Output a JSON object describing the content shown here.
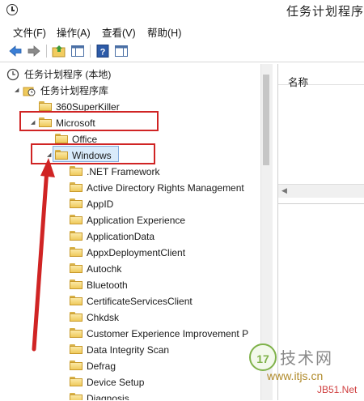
{
  "window": {
    "title": "任务计划程序"
  },
  "menu": [
    {
      "label": "文件(F)"
    },
    {
      "label": "操作(A)"
    },
    {
      "label": "查看(V)"
    },
    {
      "label": "帮助(H)"
    }
  ],
  "toolbar": {
    "icons": [
      "back-arrow-icon",
      "forward-arrow-icon",
      "up-folder-icon",
      "show-hide-tree-icon",
      "help-icon",
      "action-pane-icon"
    ]
  },
  "tree": {
    "root": "任务计划程序 (本地)",
    "library": "任务计划程序库",
    "top_folders": [
      "360SuperKiller",
      "Microsoft"
    ],
    "microsoft_children": [
      "Office",
      "Windows"
    ],
    "windows_children": [
      ".NET Framework",
      "Active Directory Rights Management",
      "AppID",
      "Application Experience",
      "ApplicationData",
      "AppxDeploymentClient",
      "Autochk",
      "Bluetooth",
      "CertificateServicesClient",
      "Chkdsk",
      "Customer Experience Improvement P",
      "Data Integrity Scan",
      "Defrag",
      "Device Setup",
      "Diagnosis"
    ]
  },
  "right_pane": {
    "column_name": "名称"
  },
  "watermark": {
    "badge": "17",
    "title": "技术网",
    "url": "www.itjs.cn",
    "brand": "JB51.Net"
  },
  "colors": {
    "annotation": "#d02424",
    "selection": "#d9ebfb",
    "folder": "#efca5c"
  }
}
